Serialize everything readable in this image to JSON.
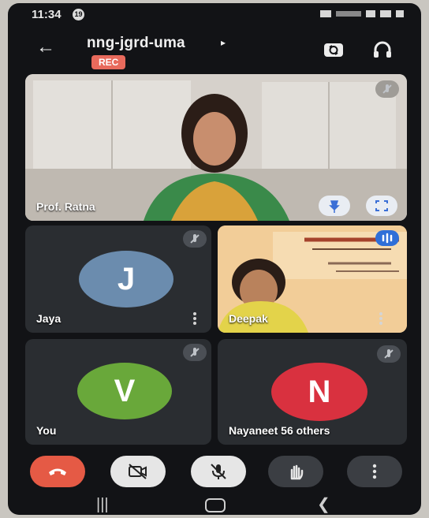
{
  "status_bar": {
    "time": "11:34",
    "notification_count": "19"
  },
  "header": {
    "meet_code": "nng-jgrd-uma",
    "rec_label": "REC"
  },
  "main_speaker": {
    "name": "Prof. Ratna"
  },
  "participants": [
    {
      "name": "Jaya",
      "initial": "J",
      "avatar_color": "#6b8cae"
    },
    {
      "name": "Deepak"
    },
    {
      "name": "You",
      "initial": "V",
      "avatar_color": "#69a83a"
    },
    {
      "name": "Nayaneet",
      "initial": "N",
      "avatar_color": "#d9313f",
      "others_label": "56 others"
    }
  ],
  "controls": [
    {
      "name": "end-call",
      "icon": "phone-hangup-icon",
      "color": "#e55a45"
    },
    {
      "name": "camera-off",
      "icon": "video-off-icon"
    },
    {
      "name": "mic-off",
      "icon": "mic-off-icon"
    },
    {
      "name": "raise-hand",
      "icon": "hand-icon"
    },
    {
      "name": "more-options",
      "icon": "more-vertical-icon"
    }
  ]
}
